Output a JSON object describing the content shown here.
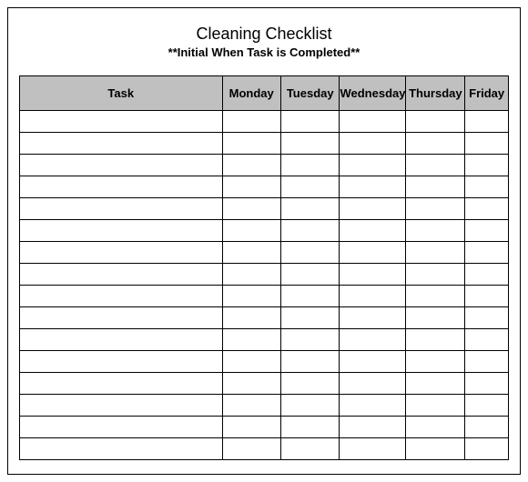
{
  "title": "Cleaning Checklist",
  "subtitle": "**Initial When Task is Completed**",
  "columns": [
    "Task",
    "Monday",
    "Tuesday",
    "Wednesday",
    "Thursday",
    "Friday"
  ],
  "row_count": 16
}
